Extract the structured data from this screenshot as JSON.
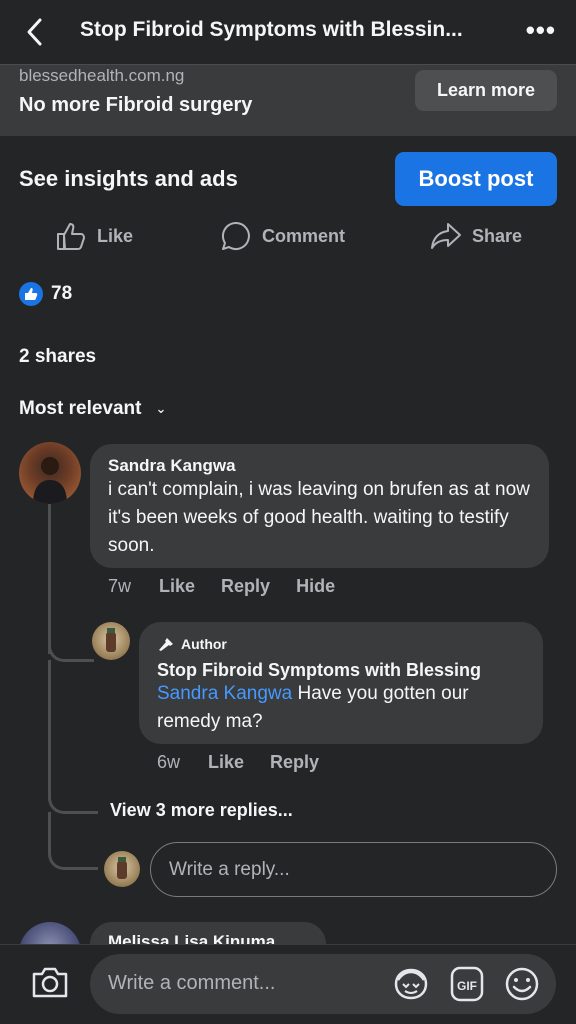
{
  "header": {
    "title": "Stop Fibroid Symptoms with Blessin...",
    "back_icon": "chevron-left-icon",
    "more_icon": "more-horizontal-icon",
    "more_glyph": "•••"
  },
  "ad": {
    "url": "blessedhealth.com.ng",
    "headline": "No more Fibroid surgery",
    "cta_label": "Learn more"
  },
  "insights": {
    "label": "See insights and ads",
    "boost_label": "Boost post",
    "boost_color": "#1b74e4"
  },
  "actions": {
    "like": "Like",
    "comment": "Comment",
    "share": "Share"
  },
  "stats": {
    "reaction_count": "78",
    "shares": "2 shares"
  },
  "sort": {
    "label": "Most relevant",
    "chevron": "⌄"
  },
  "comments": [
    {
      "name": "Sandra Kangwa",
      "text": "i can't complain, i was leaving on brufen as at now it's been weeks of good health. waiting to testify soon.",
      "time": "7w",
      "like": "Like",
      "reply": "Reply",
      "hide": "Hide"
    }
  ],
  "reply": {
    "badge": "Author",
    "name": "Stop Fibroid Symptoms with Blessing",
    "mention": "Sandra Kangwa",
    "text": " Have you gotten our remedy ma?",
    "time": "6w",
    "like": "Like",
    "reply": "Reply"
  },
  "thread": {
    "more_replies": "View 3 more replies...",
    "reply_placeholder": "Write a reply..."
  },
  "next_comment": {
    "name": "Melissa Lisa Kinuma"
  },
  "composer": {
    "placeholder": "Write a comment...",
    "camera_icon": "camera-icon",
    "avatar_sticker_icon": "avatar-sticker-icon",
    "gif_label": "GIF",
    "emoji_icon": "emoji-icon"
  },
  "colors": {
    "background": "#242526",
    "surface": "#3a3b3c",
    "accent": "#1b74e4",
    "mention": "#4599ff"
  }
}
